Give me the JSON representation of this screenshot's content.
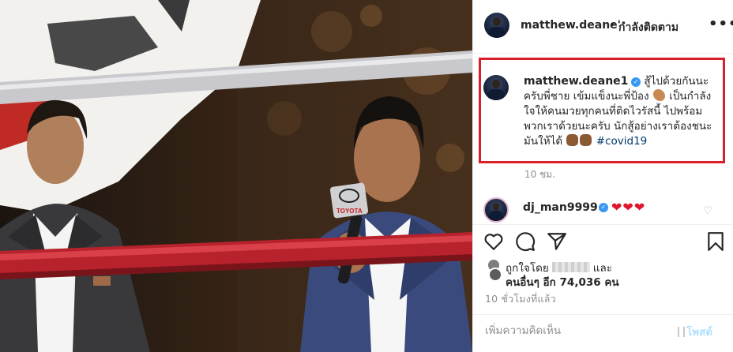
{
  "post": {
    "author": "matthew.deane'",
    "separator": "•",
    "follow_status": "กำลังติดตาม",
    "more_label": "•••"
  },
  "caption": {
    "username": "matthew.deane1",
    "text_part1": "สู้ไปด้วยกันนะครับพี่ชาย เข้มแข็งนะพี่ป้อง",
    "text_part2": "เป็นกำลังใจให้คนมวยทุกคนที่ติดไวรัสนี้ ไปพร้อมพวกเราด้วยนะครับ นักสู้อย่างเราต้องชนะมันให้ได้",
    "hashtag": "#covid19",
    "time": "10 ชม."
  },
  "comment": {
    "username": "dj_man9999",
    "text": "❤❤❤"
  },
  "likes": {
    "prefix": "ถูกใจโดย",
    "suffix": "และ",
    "others": "คนอื่นๆ อีก 74,036 คน"
  },
  "timestamp": "10 ชั่วโมงที่แล้ว",
  "comment_box": {
    "placeholder": "เพิ่มความคิดเห็น",
    "post_label": "โพสต์"
  },
  "photo": {
    "mic_flag_text": "TOYOTA"
  },
  "icons": {
    "verified": "verified-badge-icon",
    "like": "heart-outline-icon",
    "comment": "speech-bubble-icon",
    "share": "paper-plane-icon",
    "save": "bookmark-icon"
  },
  "colors": {
    "highlight_border": "#d9202a",
    "hashtag": "#00376b",
    "verified": "#3897f0",
    "post_button_disabled": "#b2dffc"
  }
}
